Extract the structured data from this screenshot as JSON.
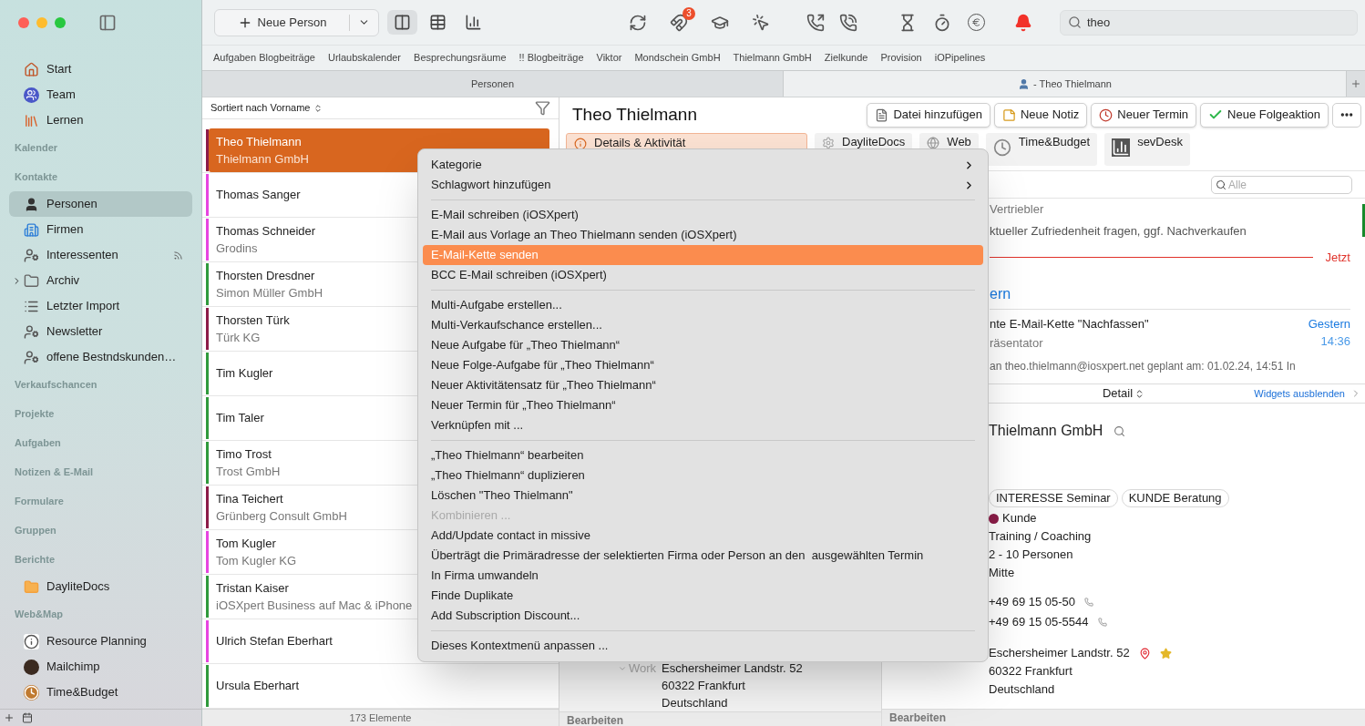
{
  "toolbar": {
    "new_button": "Neue Person",
    "views": [
      {
        "selected": true
      },
      {
        "selected": false
      },
      {
        "selected": false
      }
    ],
    "badge": "3",
    "search": {
      "value": "theo"
    }
  },
  "favorites": [
    "Aufgaben Blogbeiträge",
    "Urlaubskalender",
    "Besprechungsräume",
    "!! Blogbeiträge",
    "Viktor",
    "Mondschein GmbH",
    "Thielmann GmbH",
    "Zielkunde",
    "Provision",
    "iOPipelines"
  ],
  "tabs": [
    {
      "label": "Personen",
      "selected": false,
      "kind": "list"
    },
    {
      "label": "- Theo Thielmann",
      "selected": true,
      "kind": "person"
    }
  ],
  "sidebar": {
    "sections": [
      {
        "items": [
          {
            "label": "Start",
            "selected": false,
            "kind": "item"
          },
          {
            "label": "Team",
            "selected": false,
            "kind": "item"
          },
          {
            "label": "Lernen",
            "selected": false,
            "kind": "item"
          }
        ]
      },
      {
        "header": "Kalender"
      },
      {
        "header": "Kontakte",
        "items": [
          {
            "label": "Personen",
            "selected": true,
            "kind": "item"
          },
          {
            "label": "Firmen",
            "selected": false,
            "kind": "item"
          },
          {
            "label": "Interessenten",
            "selected": false,
            "kind": "item"
          },
          {
            "label": "Archiv",
            "selected": false,
            "kind": "group",
            "expanded": false
          },
          {
            "label": "Letzter Import",
            "selected": false,
            "kind": "item"
          },
          {
            "label": "Newsletter",
            "selected": false,
            "kind": "item"
          },
          {
            "label": "offene Bestndskunden…",
            "selected": false,
            "kind": "item"
          }
        ]
      },
      {
        "header": "Verkaufschancen"
      },
      {
        "header": "Projekte"
      },
      {
        "header": "Aufgaben"
      },
      {
        "header": "Notizen & E-Mail"
      },
      {
        "header": "Formulare"
      },
      {
        "header": "Gruppen"
      },
      {
        "header": "Berichte",
        "items": [
          {
            "label": "DayliteDocs",
            "selected": false,
            "kind": "item"
          }
        ]
      },
      {
        "header": "Web&Map",
        "items": [
          {
            "label": "Resource Planning",
            "selected": false,
            "kind": "item"
          },
          {
            "label": "Mailchimp",
            "selected": false,
            "kind": "item"
          },
          {
            "label": "Time&Budget",
            "selected": false,
            "kind": "item"
          }
        ]
      }
    ]
  },
  "list": {
    "sort": "Sortiert nach Vorname",
    "footer": "173 Elemente",
    "rows": [
      {
        "name": "Theo Thielmann",
        "company": "Thielmann GmbH",
        "color": "#8c1c48",
        "selected": true
      },
      {
        "name": "Thomas Sanger",
        "color": "#e645e0",
        "selected": false
      },
      {
        "name": "Thomas Schneider",
        "company": "Grodins",
        "color": "#e645e0",
        "selected": false
      },
      {
        "name": "Thorsten Dresdner",
        "company": "Simon Müller GmbH",
        "color": "#2f9a3c",
        "selected": false
      },
      {
        "name": "Thorsten Türk",
        "company": "Türk KG",
        "color": "#8c1c48",
        "selected": false
      },
      {
        "name": "Tim Kugler",
        "color": "#2f9a3c",
        "selected": false
      },
      {
        "name": "Tim Taler",
        "color": "#2f9a3c",
        "selected": false
      },
      {
        "name": "Timo Trost",
        "company": "Trost GmbH",
        "color": "#2f9a3c",
        "selected": false
      },
      {
        "name": "Tina Teichert",
        "company": "Grünberg Consult GmbH",
        "color": "#8c1c48",
        "selected": false
      },
      {
        "name": "Tom Kugler",
        "company": "Tom Kugler KG",
        "color": "#e645e0",
        "selected": false
      },
      {
        "name": "Tristan Kaiser",
        "company": "iOSXpert Business auf Mac & iPhone",
        "color": "#2f9a3c",
        "selected": false
      },
      {
        "name": "Ulrich Stefan Eberhart",
        "color": "#e645e0",
        "selected": false
      },
      {
        "name": "Ursula Eberhart",
        "color": "#2f9a3c",
        "selected": false
      }
    ]
  },
  "detail": {
    "name": "Theo Thielmann",
    "actions": [
      "Datei hinzufügen",
      "Neue Notiz",
      "Neuer Termin",
      "Neue Folgeaktion"
    ],
    "tabs": [
      {
        "label": "Details & Aktivität",
        "selected": true
      },
      {
        "label": "DayliteDocs",
        "selected": false
      },
      {
        "label": "Web",
        "selected": false
      },
      {
        "label": "Time&Budget",
        "selected": false
      },
      {
        "label": "sevDesk",
        "selected": false
      }
    ],
    "filter_placeholder": "Alle",
    "activity": [
      {
        "kind": "task",
        "role": "Vertriebler",
        "text": "ktueller Zufriedenheit fragen, ggf. Nachverkaufen"
      },
      {
        "kind": "now",
        "label": "Jetzt"
      },
      {
        "kind": "heading",
        "label": "ern"
      },
      {
        "kind": "mail",
        "title": "nte E-Mail-Kette \"Nachfassen\"",
        "subtitle": "räsentator",
        "body": "an theo.thielmann@iosxpert.net geplant am: 01.02.24, 14:51 In",
        "date": "Gestern",
        "time": "14:36"
      }
    ],
    "detail_bar": {
      "label": "Detail",
      "link": "Widgets ausblenden"
    },
    "person_address": {
      "label": "Work",
      "lines": [
        "Eschersheimer Landstr. 52",
        "60322 Frankfurt",
        "Deutschland"
      ],
      "footer": "Bearbeiten"
    },
    "company": {
      "name": "Thielmann GmbH",
      "tags": [
        "INTERESSE Seminar",
        "KUNDE Beratung"
      ],
      "category": {
        "label": "Kunde",
        "color": "#8c1c48"
      },
      "fields": [
        "Training / Coaching",
        "2 - 10 Personen",
        "Mitte"
      ],
      "phones": [
        "+49 69 15 05-50",
        "+49 69 15 05-5544"
      ],
      "address": {
        "lines": [
          "Eschersheimer Landstr. 52",
          "60322 Frankfurt",
          "Deutschland"
        ],
        "primary": true
      },
      "footer": "Bearbeiten"
    }
  },
  "context_menu": [
    {
      "kind": "item",
      "label": "Kategorie",
      "submenu": true,
      "selected": false,
      "disabled": false
    },
    {
      "kind": "item",
      "label": "Schlagwort hinzufügen",
      "submenu": true,
      "selected": false,
      "disabled": false
    },
    {
      "kind": "separator"
    },
    {
      "kind": "item",
      "label": "E-Mail schreiben (iOSXpert)",
      "submenu": false,
      "selected": false,
      "disabled": false
    },
    {
      "kind": "item",
      "label": "E-Mail aus Vorlage an Theo Thielmann senden (iOSXpert)",
      "submenu": false,
      "selected": false,
      "disabled": false
    },
    {
      "kind": "item",
      "label": "E-Mail-Kette senden",
      "submenu": false,
      "selected": true,
      "disabled": false
    },
    {
      "kind": "item",
      "label": "BCC E-Mail schreiben (iOSXpert)",
      "submenu": false,
      "selected": false,
      "disabled": false
    },
    {
      "kind": "separator"
    },
    {
      "kind": "item",
      "label": "Multi-Aufgabe erstellen...",
      "submenu": false,
      "selected": false,
      "disabled": false
    },
    {
      "kind": "item",
      "label": "Multi-Verkaufschance erstellen...",
      "submenu": false,
      "selected": false,
      "disabled": false
    },
    {
      "kind": "item",
      "label": "Neue Aufgabe für „Theo Thielmann“",
      "submenu": false,
      "selected": false,
      "disabled": false
    },
    {
      "kind": "item",
      "label": "Neue Folge-Aufgabe für „Theo Thielmann“",
      "submenu": false,
      "selected": false,
      "disabled": false
    },
    {
      "kind": "item",
      "label": "Neuer Aktivitätensatz für „Theo Thielmann“",
      "submenu": false,
      "selected": false,
      "disabled": false
    },
    {
      "kind": "item",
      "label": "Neuer Termin für „Theo Thielmann“",
      "submenu": false,
      "selected": false,
      "disabled": false
    },
    {
      "kind": "item",
      "label": "Verknüpfen mit ...",
      "submenu": false,
      "selected": false,
      "disabled": false
    },
    {
      "kind": "separator"
    },
    {
      "kind": "item",
      "label": "„Theo Thielmann“ bearbeiten",
      "submenu": false,
      "selected": false,
      "disabled": false
    },
    {
      "kind": "item",
      "label": "„Theo Thielmann“ duplizieren",
      "submenu": false,
      "selected": false,
      "disabled": false
    },
    {
      "kind": "item",
      "label": "Löschen \"Theo Thielmann\"",
      "submenu": false,
      "selected": false,
      "disabled": false
    },
    {
      "kind": "item",
      "label": "Kombinieren ...",
      "submenu": false,
      "selected": false,
      "disabled": true
    },
    {
      "kind": "item",
      "label": "Add/Update contact in missive",
      "submenu": false,
      "selected": false,
      "disabled": false
    },
    {
      "kind": "item",
      "label": "Überträgt die Primäradresse der selektierten Firma oder Person an den  ausgewählten Termin",
      "submenu": false,
      "selected": false,
      "disabled": false
    },
    {
      "kind": "item",
      "label": "In Firma umwandeln",
      "submenu": false,
      "selected": false,
      "disabled": false
    },
    {
      "kind": "item",
      "label": "Finde Duplikate",
      "submenu": false,
      "selected": false,
      "disabled": false
    },
    {
      "kind": "item",
      "label": "Add Subscription Discount...",
      "submenu": false,
      "selected": false,
      "disabled": false
    },
    {
      "kind": "separator"
    },
    {
      "kind": "item",
      "label": "Dieses Kontextmenü anpassen ...",
      "submenu": false,
      "selected": false,
      "disabled": false
    }
  ]
}
